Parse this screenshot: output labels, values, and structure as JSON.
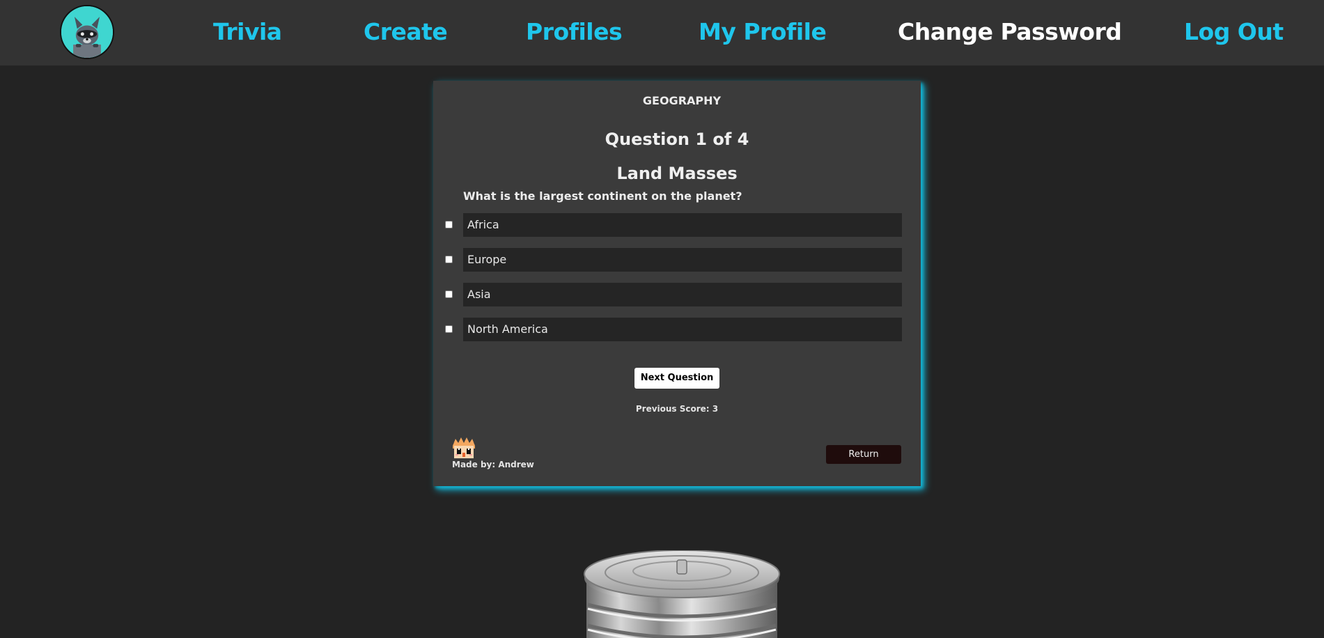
{
  "nav": {
    "links": [
      {
        "label": "Trivia",
        "active": false
      },
      {
        "label": "Create",
        "active": false
      },
      {
        "label": "Profiles",
        "active": false
      },
      {
        "label": "My Profile",
        "active": false
      },
      {
        "label": "Change Password",
        "active": true
      },
      {
        "label": "Log Out",
        "active": false
      }
    ],
    "logo_icon": "raccoon-logo-icon"
  },
  "quiz": {
    "category": "GEOGRAPHY",
    "question_number": "Question 1 of 4",
    "question_title": "Land Masses",
    "question_text": "What is the largest continent on the planet?",
    "answers": [
      {
        "label": "Africa",
        "checked": false
      },
      {
        "label": "Europe",
        "checked": false
      },
      {
        "label": "Asia",
        "checked": false
      },
      {
        "label": "North America",
        "checked": false
      }
    ],
    "next_button": "Next Question",
    "previous_score": "Previous Score: 3",
    "made_by": "Made by: Andrew",
    "return_button": "Return"
  },
  "colors": {
    "accent": "#1fc6ec",
    "background": "#232323",
    "navbar": "#333333",
    "card": "#3b3b3b",
    "card_glow": "#16b7d8",
    "answer_box": "#252525",
    "return_button": "#1f0c0c"
  },
  "icons": {
    "avatar": "creator-avatar-icon",
    "trash": "trash-can-icon"
  }
}
